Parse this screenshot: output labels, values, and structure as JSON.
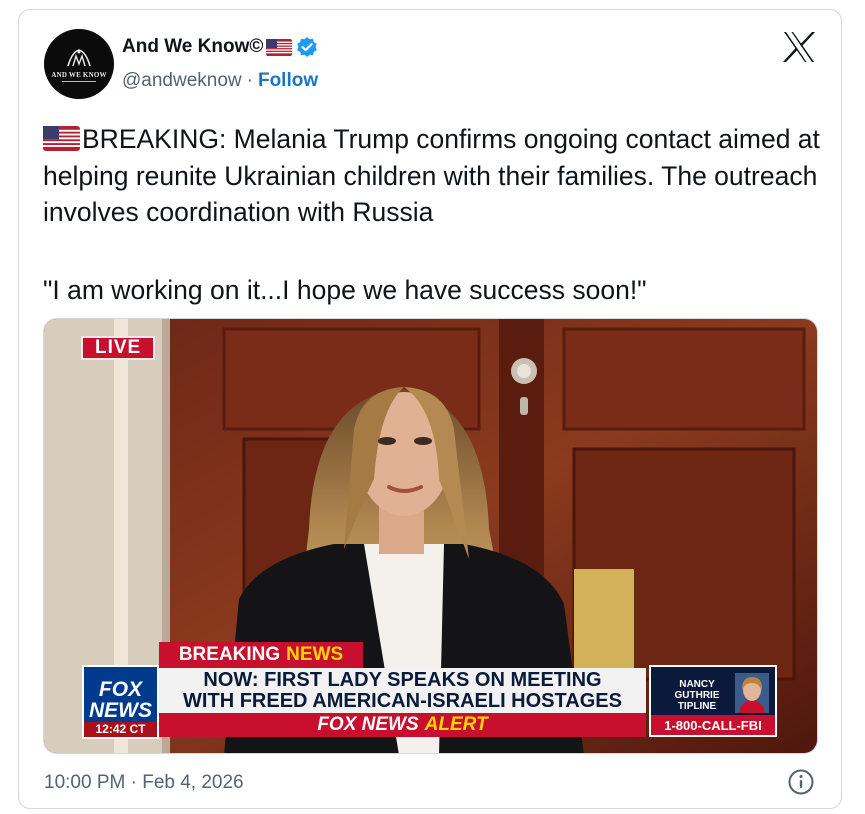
{
  "author": {
    "display_name": "And We Know©",
    "handle": "@andweknow",
    "separator": "·",
    "follow_label": "Follow",
    "avatar_text": "AND WE KNOW"
  },
  "tweet": {
    "text": "BREAKING: Melania Trump confirms ongoing contact aimed at helping reunite Ukrainian children with their families. The outreach involves coordination with Russia",
    "quote": "\"I am working on it...I hope we have success soon!\"",
    "timestamp": "10:00 PM · Feb 4, 2026"
  },
  "media": {
    "live_label": "LIVE",
    "breaking_label": "BREAKING",
    "news_label": "NEWS",
    "headline_line1": "NOW: FIRST LADY SPEAKS ON MEETING",
    "headline_line2": "WITH FREED AMERICAN-ISRAELI HOSTAGES",
    "alert_brand": "FOX NEWS",
    "alert_word": "ALERT",
    "logo_line1": "FOX",
    "logo_line2": "NEWS",
    "clock": "12:42 CT",
    "tipline_title": "NANCY GUTHRIE TIPLINE",
    "tipline_phone": "1-800-CALL-FBI"
  },
  "icons": {
    "brand": "x-logo-icon",
    "verified": "verified-badge-icon",
    "flag": "us-flag-icon",
    "info": "info-icon"
  },
  "colors": {
    "follow": "#1d74c5",
    "secondary_text": "#536471",
    "verified": "#1d9bf0",
    "fox_red": "#c8102e",
    "fox_blue": "#003a8c",
    "fox_yellow": "#ffd700"
  }
}
